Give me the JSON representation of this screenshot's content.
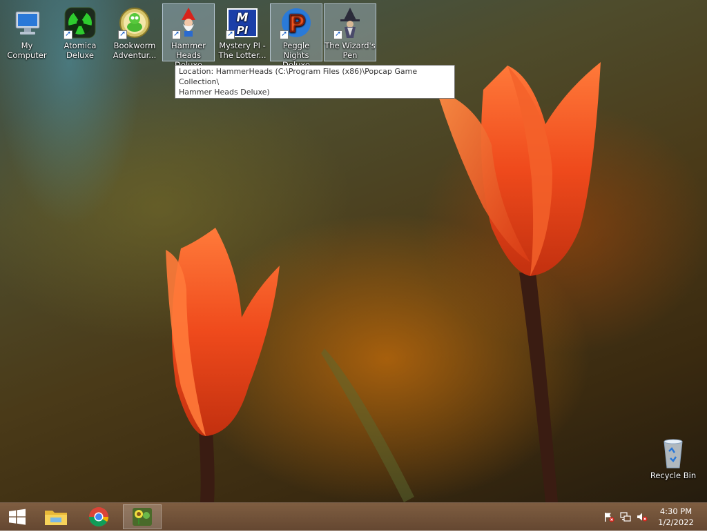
{
  "desktop_icons": [
    {
      "label": "My Computer",
      "icon": "computer-icon",
      "shortcut": false,
      "selected": false
    },
    {
      "label": "Atomica Deluxe",
      "icon": "atomica-icon",
      "shortcut": true,
      "selected": false
    },
    {
      "label": "Bookworm Adventur...",
      "icon": "bookworm-icon",
      "shortcut": true,
      "selected": false
    },
    {
      "label": "Hammer Heads Deluxe",
      "icon": "gnome-icon",
      "shortcut": true,
      "selected": true
    },
    {
      "label": "Mystery PI - The Lotter...",
      "icon": "mpi-icon",
      "shortcut": true,
      "selected": false
    },
    {
      "label": "Peggle Nights Deluxe",
      "icon": "peggle-icon",
      "shortcut": true,
      "selected": true
    },
    {
      "label": "The Wizard's Pen",
      "icon": "wizard-icon",
      "shortcut": true,
      "selected": true
    }
  ],
  "recycle_bin": {
    "label": "Recycle Bin",
    "icon": "recycle-bin-icon"
  },
  "tooltip": {
    "line1": "Location: HammerHeads (C:\\Program Files (x86)\\Popcap Game Collection\\",
    "line2": "Hammer Heads Deluxe)"
  },
  "taskbar": {
    "start": "windows-start-icon",
    "pinned": [
      "file-explorer-icon",
      "chrome-icon",
      "plants-vs-zombies-icon"
    ],
    "tray": [
      "action-center-flag-icon",
      "network-icon",
      "volume-muted-icon"
    ],
    "time": "4:30 PM",
    "date": "1/2/2022"
  },
  "colors": {
    "taskbar": "#6e4b31",
    "selection": "#bed7f0",
    "tulip": "#e8451c"
  }
}
